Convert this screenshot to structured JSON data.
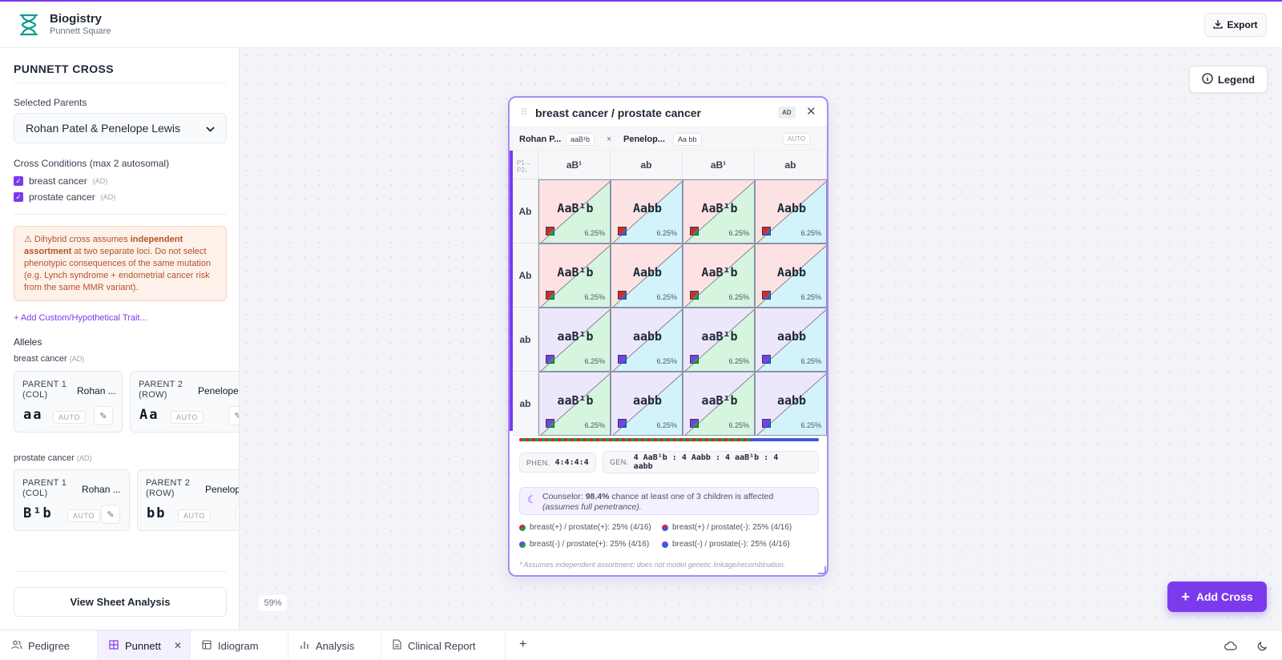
{
  "app": {
    "title": "Biogistry",
    "subtitle": "Punnett Square",
    "export_label": "Export",
    "accent_color": "#7c3aed"
  },
  "sidebar": {
    "title": "PUNNETT CROSS",
    "parents_label": "Selected Parents",
    "parents_value": "Rohan Patel & Penelope Lewis",
    "conditions_label": "Cross Conditions (max 2 autosomal)",
    "conditions": [
      {
        "name": "breast cancer",
        "tag": "(AD)",
        "checked": true
      },
      {
        "name": "prostate cancer",
        "tag": "(AD)",
        "checked": true
      }
    ],
    "warning": {
      "prefix": "⚠ Dihybrid cross assumes ",
      "bold": "independent assortment",
      "suffix": " at two separate loci. Do not select phenotypic consequences of the same mutation (e.g. Lynch syndrome + endometrial cancer risk from the same MMR variant)."
    },
    "add_trait_label": "+ Add Custom/Hypothetical Trait...",
    "alleles_label": "Alleles",
    "loci": [
      {
        "name": "breast cancer",
        "tag": "(AD)",
        "p1": {
          "label": "PARENT 1 (COL)",
          "name": "Rohan ...",
          "genotype": "aa",
          "auto": "AUTO"
        },
        "p2": {
          "label": "PARENT 2 (ROW)",
          "name": "Penelope",
          "genotype": "Aa",
          "auto": "AUTO"
        }
      },
      {
        "name": "prostate cancer",
        "tag": "(AD)",
        "p1": {
          "label": "PARENT 1 (COL)",
          "name": "Rohan ...",
          "genotype": "B¹b",
          "auto": "AUTO"
        },
        "p2": {
          "label": "PARENT 2 (ROW)",
          "name": "Penelop",
          "genotype": "bb",
          "auto": "AUTO"
        }
      }
    ],
    "view_button": "View Sheet Analysis"
  },
  "canvas": {
    "legend_label": "Legend",
    "zoom": "59%",
    "add_cross_label": "Add Cross"
  },
  "panel": {
    "title": "breast cancer / prostate cancer",
    "badge": "AD",
    "parent1": {
      "name": "Rohan P...",
      "genotype": "aaB¹b"
    },
    "cross_symbol": "×",
    "parent2": {
      "name": "Penelop...",
      "genotype": "Aa bb"
    },
    "auto_label": "AUTO",
    "corner_top": "P1→",
    "corner_bottom": "P2↓",
    "col_gametes": [
      "aB¹",
      "ab",
      "aB¹",
      "ab"
    ],
    "row_gametes": [
      "Ab",
      "Ab",
      "ab",
      "ab"
    ],
    "cells": [
      [
        {
          "g": "AaB¹b",
          "p": "6.25%",
          "top": "#fde2e4",
          "bot": "#d5f5df",
          "s1": "#dc2626",
          "s2": "#16a34a"
        },
        {
          "g": "Aabb",
          "p": "6.25%",
          "top": "#fde2e4",
          "bot": "#d3f3fa",
          "s1": "#dc2626",
          "s2": "#2563eb"
        },
        {
          "g": "AaB¹b",
          "p": "6.25%",
          "top": "#fde2e4",
          "bot": "#d5f5df",
          "s1": "#dc2626",
          "s2": "#16a34a"
        },
        {
          "g": "Aabb",
          "p": "6.25%",
          "top": "#fde2e4",
          "bot": "#d3f3fa",
          "s1": "#dc2626",
          "s2": "#2563eb"
        }
      ],
      [
        {
          "g": "AaB¹b",
          "p": "6.25%",
          "top": "#fde2e4",
          "bot": "#d5f5df",
          "s1": "#dc2626",
          "s2": "#16a34a"
        },
        {
          "g": "Aabb",
          "p": "6.25%",
          "top": "#fde2e4",
          "bot": "#d3f3fa",
          "s1": "#dc2626",
          "s2": "#2563eb"
        },
        {
          "g": "AaB¹b",
          "p": "6.25%",
          "top": "#fde2e4",
          "bot": "#d5f5df",
          "s1": "#dc2626",
          "s2": "#16a34a"
        },
        {
          "g": "Aabb",
          "p": "6.25%",
          "top": "#fde2e4",
          "bot": "#d3f3fa",
          "s1": "#dc2626",
          "s2": "#2563eb"
        }
      ],
      [
        {
          "g": "aaB¹b",
          "p": "6.25%",
          "top": "#ede7fb",
          "bot": "#d5f5df",
          "s1": "#7c3aed",
          "s2": "#16a34a"
        },
        {
          "g": "aabb",
          "p": "6.25%",
          "top": "#ede7fb",
          "bot": "#d3f3fa",
          "s1": "#7c3aed",
          "s2": "#2563eb"
        },
        {
          "g": "aaB¹b",
          "p": "6.25%",
          "top": "#ede7fb",
          "bot": "#d5f5df",
          "s1": "#7c3aed",
          "s2": "#16a34a"
        },
        {
          "g": "aabb",
          "p": "6.25%",
          "top": "#ede7fb",
          "bot": "#d3f3fa",
          "s1": "#7c3aed",
          "s2": "#2563eb"
        }
      ],
      [
        {
          "g": "aaB¹b",
          "p": "6.25%",
          "top": "#ede7fb",
          "bot": "#d5f5df",
          "s1": "#7c3aed",
          "s2": "#16a34a"
        },
        {
          "g": "aabb",
          "p": "6.25%",
          "top": "#ede7fb",
          "bot": "#d3f3fa",
          "s1": "#7c3aed",
          "s2": "#2563eb"
        },
        {
          "g": "aaB¹b",
          "p": "6.25%",
          "top": "#ede7fb",
          "bot": "#d5f5df",
          "s1": "#7c3aed",
          "s2": "#16a34a"
        },
        {
          "g": "aabb",
          "p": "6.25%",
          "top": "#ede7fb",
          "bot": "#d3f3fa",
          "s1": "#7c3aed",
          "s2": "#2563eb"
        }
      ]
    ],
    "phen_label": "PHEN.",
    "phen_value": "4:4:4:4",
    "gen_label": "GEN.",
    "gen_value_line1": "4 AaB¹b : 4 Aabb : 4 aaB¹b : 4",
    "gen_value_line2": "aabb",
    "counselor": {
      "prefix": "Counselor: ",
      "bold": "98.4%",
      "suffix": " chance at least one of 3 children is affected",
      "note": "(assumes full penetrance)."
    },
    "phenotypes": [
      {
        "label": "breast(+) / prostate(+): 25% (4/16)",
        "c1": "#dc2626",
        "c2": "#16a34a"
      },
      {
        "label": "breast(+) / prostate(-): 25% (4/16)",
        "c1": "#dc2626",
        "c2": "#2563eb"
      },
      {
        "label": "breast(-) / prostate(+): 25% (4/16)",
        "c1": "#7c3aed",
        "c2": "#16a34a"
      },
      {
        "label": "breast(-) / prostate(-): 25% (4/16)",
        "c1": "#7c3aed",
        "c2": "#2563eb"
      }
    ],
    "footnote": "* Assumes independent assortment; does not model genetic linkage/recombination."
  },
  "tabs": [
    {
      "label": "Pedigree",
      "icon": "people-icon",
      "active": false
    },
    {
      "label": "Punnett",
      "icon": "grid-icon",
      "active": true
    },
    {
      "label": "Idiogram",
      "icon": "table-icon",
      "active": false
    },
    {
      "label": "Analysis",
      "icon": "bar-chart-icon",
      "active": false
    },
    {
      "label": "Clinical Report",
      "icon": "document-icon",
      "active": false
    }
  ],
  "tab_add": "+"
}
